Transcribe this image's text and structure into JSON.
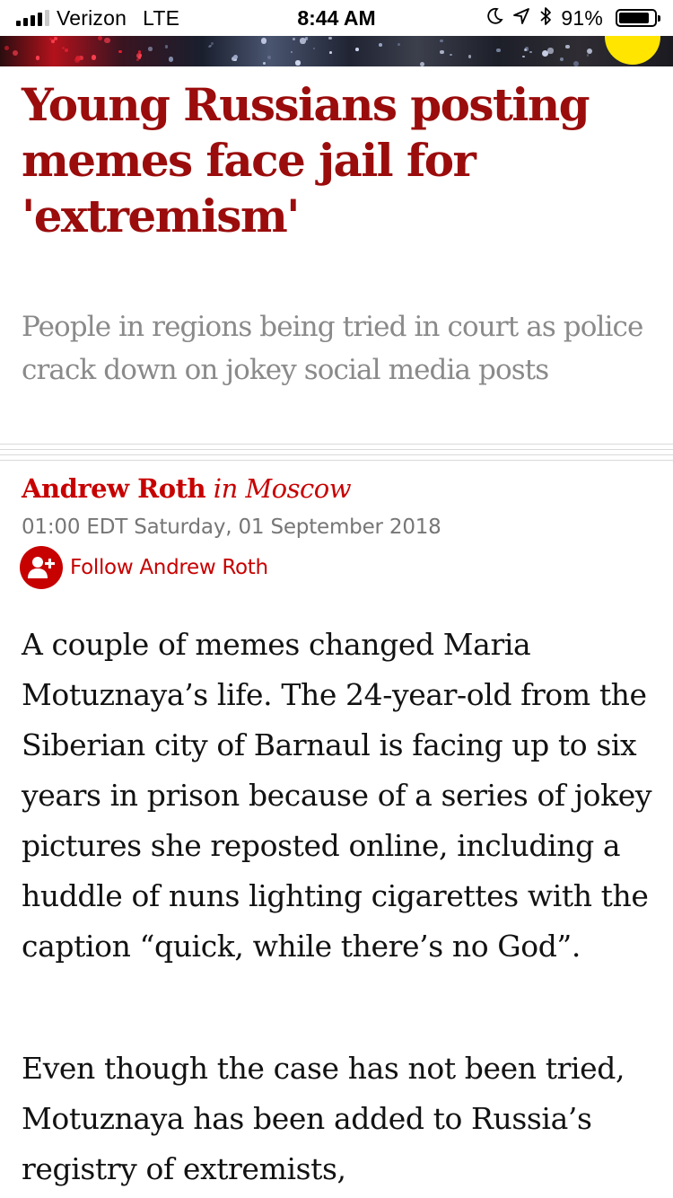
{
  "status_bar": {
    "carrier": "Verizon",
    "network": "LTE",
    "time": "8:44 AM",
    "battery_percent_label": "91%",
    "battery_level": 0.91,
    "signal_bars_filled": 4,
    "signal_bars_total": 5,
    "icons": [
      "moon-icon",
      "location-arrow-icon",
      "bluetooth-icon",
      "battery-icon"
    ]
  },
  "article": {
    "headline": "Young Russians posting memes face jail for 'extremism'",
    "standfirst": "People in regions being tried in court as police crack down on jokey social media posts",
    "byline": {
      "author": "Andrew Roth",
      "location": "in Moscow"
    },
    "dateline": "01:00 EDT Saturday, 01 September 2018",
    "follow_label": "Follow Andrew Roth",
    "paragraphs": [
      "A couple of memes changed Maria Motuznaya’s life. The 24-year-old from the Siberian city of Barnaul is facing up to six years in prison because of a series of jokey pictures she reposted online, including a huddle of nuns lighting cigarettes with the caption “quick, while there’s no God”.",
      "Even though the case has not been tried, Motuznaya has been added to Russia’s registry of extremists,"
    ]
  },
  "colors": {
    "headline": "#9b0c0c",
    "accent": "#c70000",
    "standfirst": "#8a8a8a",
    "meta": "#767676",
    "body": "#121212",
    "badge": "#ffe500"
  }
}
